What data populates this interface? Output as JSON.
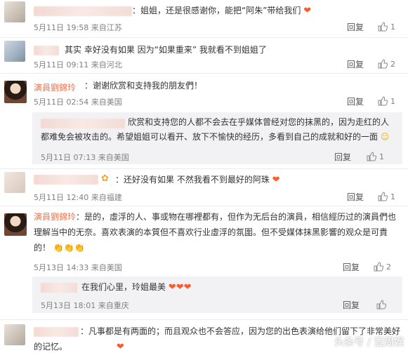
{
  "comments": [
    {
      "text": "：姐姐，还是很感谢你，能把“阿朱”带给我们",
      "meta": "5月11日 19:58 来自江苏",
      "reply": "回复",
      "likes": "1"
    },
    {
      "text": "其实 幸好没有如果 因为“如果重来” 我就看不到姐姐了",
      "meta": "5月11日 09:11 来自河北",
      "reply": "回复",
      "likes": "2"
    },
    {
      "author": "演員劉錦玲",
      "text": "：谢谢欣赏和支持我的朋友們！",
      "meta": "5月11日 02:54 来自美国",
      "reply": "回复",
      "likes": "1",
      "sub": {
        "text": "欣赏和支持您的人都不会去在乎媒体曾经对您的抹黑的，因为走红的人都难免会被攻击的。希望姐姐可以看开、放下不愉快的经历，多看到自己的成就和好的一面",
        "meta": "5月11日 07:13 来自美国",
        "reply": "回复",
        "likes": "1"
      }
    },
    {
      "text": "：还好没有如果 不然我看不到最好的阿珠",
      "meta": "5月11日 12:40 来自福建",
      "reply": "回复",
      "likes": "1"
    },
    {
      "author": "演員劉錦玲",
      "text": "：是的，虛浮的人、事或物在哪裡都有，但作为无后台的演員，相信經历过的演員們也理解当中的无奈。喜欢表演的本質但不喜欢行业虛浮的氛圍。但不受媒体抹黑影響的观众是可貴的！",
      "meta": "5月13日 14:33 来自美国",
      "reply": "回复",
      "likes": "2",
      "sub": {
        "text": "在我们心里，玲姐最美",
        "meta": "5月13日 18:01 来自重庆",
        "reply": "回复",
        "likes": ""
      }
    },
    {
      "text": "：凡事都是有两面的；而且观众也不会答应，因为您的出色表演给他们留下了非常美好的记忆。"
    }
  ],
  "watermark": "头条号 / 壹周娱",
  "icons": {
    "like": "thumbs-up-icon",
    "heart": "heart-icon",
    "emoji": "smile-icon",
    "clap": "clap-icon"
  },
  "colors": {
    "author": "#eb7350",
    "heart": "#ff5a2a",
    "meta": "#808080"
  }
}
